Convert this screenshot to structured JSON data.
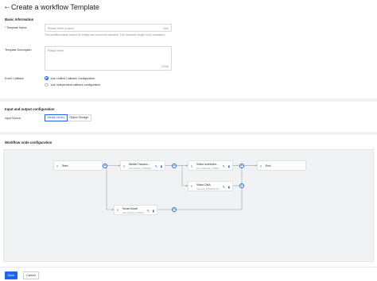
{
  "header": {
    "title": "Create a workflow Template"
  },
  "basic": {
    "section_title": "Basic Information",
    "template_name": {
      "label": "* Template Name",
      "placeholder": "Please enter a name",
      "counter": "0/64",
      "hint": "This workflow name cannot be empty and cannot be repeated. The maximum length is 64 characters."
    },
    "template_description": {
      "label": "Template Description",
      "placeholder": "Please enter",
      "counter": "0/256"
    },
    "event_callback": {
      "label": "Event Callback",
      "options": [
        {
          "label": "Use Unified Callback Configuration",
          "checked": true
        },
        {
          "label": "Use independent callback configuration",
          "checked": false
        }
      ]
    }
  },
  "io": {
    "section_title": "Input and output configuration",
    "input_source": {
      "label": "Input Source",
      "options": [
        "Media Library",
        "Object Storage"
      ],
      "selected": "Media Library"
    }
  },
  "workflow": {
    "section_title": "Workflow node configuration",
    "nodes": {
      "start": {
        "title": "Start"
      },
      "transcode": {
        "title": "Media Transco...",
        "subtitle": "sns-ransort_1752218..."
      },
      "screenshot": {
        "title": "Video screensh...",
        "subtitle": "sns-snapshot_175221..."
      },
      "dna": {
        "title": "Video DNA",
        "subtitle": "sns-dna_1752219713..."
      },
      "audit": {
        "title": "Smart Audit",
        "subtitle": "sns-censort_175218..."
      },
      "end": {
        "title": "End"
      }
    },
    "plus_symbol": "+",
    "icons": {
      "node": "node-type-icon",
      "edit": "edit-icon",
      "delete": "delete-icon"
    },
    "accent_color": "#1c64f2"
  },
  "footer": {
    "save_label": "Save",
    "cancel_label": "Cancel"
  }
}
